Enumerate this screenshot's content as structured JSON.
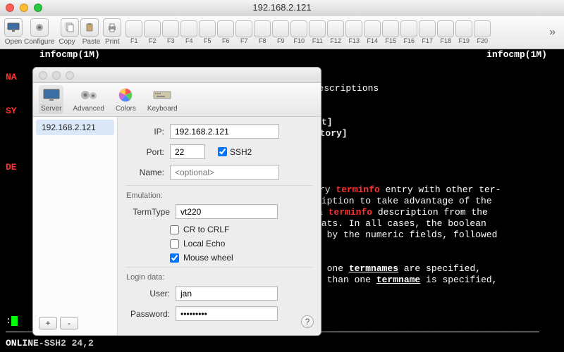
{
  "colors": {
    "traffic_close": "#ff5f57",
    "traffic_min": "#febc2e",
    "traffic_max": "#28c840"
  },
  "titlebar": {
    "title": "192.168.2.121"
  },
  "toolbar": {
    "open": "Open",
    "configure": "Configure",
    "copy": "Copy",
    "paste": "Paste",
    "print": "Print",
    "fkeys": [
      "F1",
      "F2",
      "F3",
      "F4",
      "F5",
      "F6",
      "F7",
      "F8",
      "F9",
      "F10",
      "F11",
      "F12",
      "F13",
      "F14",
      "F15",
      "F16",
      "F17",
      "F18",
      "F19",
      "F20"
    ],
    "overflow": "»"
  },
  "terminal": {
    "top_left": "infocmp(1M)",
    "top_right": "infocmp(1M)",
    "name_hdr": "NA",
    "name_frag": "o descriptions",
    "syn_hdr": "SY",
    "syn_frag1": "t]",
    "syn_frag2": "ectory]",
    "desc_hdr": "DE",
    "hi_terminfo": "terminfo",
    "desc_l1a": "ry ",
    "desc_l1b": " entry with other ter-",
    "desc_l2": "ription to take advantage of  the",
    "desc_l3a": "  a  ",
    "desc_l3b": " description from the",
    "desc_l4": "mats.  In all cases, the  boolean",
    "desc_l5": "d by the numeric fields, followed",
    "desc_l7a": "r one  ",
    "hi_termnames": "termnames",
    "desc_l7b": "  are  specified,",
    "desc_l8a": "e  than one ",
    "hi_termname": "termname",
    "desc_l8b": " is specified,",
    "status": "ONLINE-SSH2    24,2",
    "prompt": ":"
  },
  "settings": {
    "tabs": {
      "server": "Server",
      "advanced": "Advanced",
      "colors": "Colors",
      "keyboard": "Keyboard"
    },
    "sidebar": {
      "items": [
        "192.168.2.121"
      ],
      "add": "+",
      "remove": "-"
    },
    "form": {
      "ip_label": "IP:",
      "ip_value": "192.168.2.121",
      "port_label": "Port:",
      "port_value": "22",
      "ssh2_label": "SSH2",
      "ssh2_checked": true,
      "name_label": "Name:",
      "name_placeholder": "<optional>",
      "emulation_section": "Emulation:",
      "termtype_label": "TermType",
      "termtype_value": "vt220",
      "cr_label": "CR to CRLF",
      "cr_checked": false,
      "echo_label": "Local Echo",
      "echo_checked": false,
      "mouse_label": "Mouse wheel",
      "mouse_checked": true,
      "login_section": "Login data:",
      "user_label": "User:",
      "user_value": "jan",
      "password_label": "Password:",
      "password_value": "•••••••••",
      "help": "?"
    }
  }
}
